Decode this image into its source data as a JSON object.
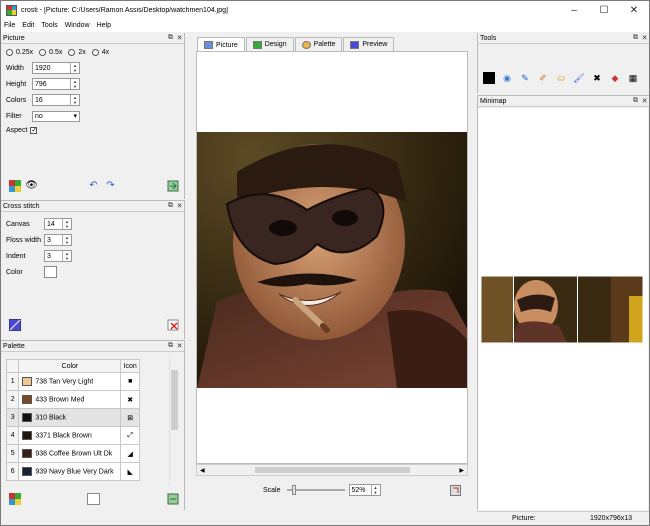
{
  "window": {
    "title": "crosti - [Picture: C:/Users/Ramon Assis/Desktop/watchmen104.jpg]",
    "controls": [
      "–",
      "☐",
      "✕"
    ]
  },
  "menu": [
    "File",
    "Edit",
    "Tools",
    "Window",
    "Help"
  ],
  "picture_panel": {
    "title": "Picture",
    "zoom_options": [
      "0.25x",
      "0.5x",
      "2x",
      "4x"
    ],
    "width_label": "Width",
    "width_value": "1920",
    "height_label": "Height",
    "height_value": "796",
    "colors_label": "Colors",
    "colors_value": "16",
    "filter_label": "Filter",
    "filter_value": "no",
    "aspect_label": "Aspect",
    "aspect_checked": "✓"
  },
  "cross_stitch_panel": {
    "title": "Cross stitch",
    "canvas_label": "Canvas",
    "canvas_value": "14",
    "floss_label": "Floss width",
    "floss_value": "3",
    "indent_label": "Indent",
    "indent_value": "3",
    "color_label": "Color"
  },
  "palette_panel": {
    "title": "Palette",
    "col_color": "Color",
    "col_icon": "Icon",
    "rows": [
      {
        "n": "1",
        "name": "738 Tan Very Light",
        "color": "#ecc894",
        "icon": "■"
      },
      {
        "n": "2",
        "name": "433 Brown Med",
        "color": "#7a4a22",
        "icon": "✖"
      },
      {
        "n": "3",
        "name": "310 Black",
        "color": "#111111",
        "icon": "⊠"
      },
      {
        "n": "4",
        "name": "3371 Black Brown",
        "color": "#1e1410",
        "icon": "⤢"
      },
      {
        "n": "5",
        "name": "938 Coffee Brown Ult Dk",
        "color": "#362014",
        "icon": "◢"
      },
      {
        "n": "6",
        "name": "939 Navy Blue Very Dark",
        "color": "#1b1f33",
        "icon": "◣"
      }
    ]
  },
  "tabs": [
    "Picture",
    "Design",
    "Palette",
    "Preview"
  ],
  "scale": {
    "label": "Scale",
    "value": "52%"
  },
  "tools_panel": {
    "title": "Tools"
  },
  "minimap_panel": {
    "title": "Minimap"
  },
  "status": {
    "label": "Picture:",
    "value": "1920x796x13"
  },
  "colors": {
    "accent": "#1a56db",
    "panel_bg": "#f0f0f0"
  }
}
